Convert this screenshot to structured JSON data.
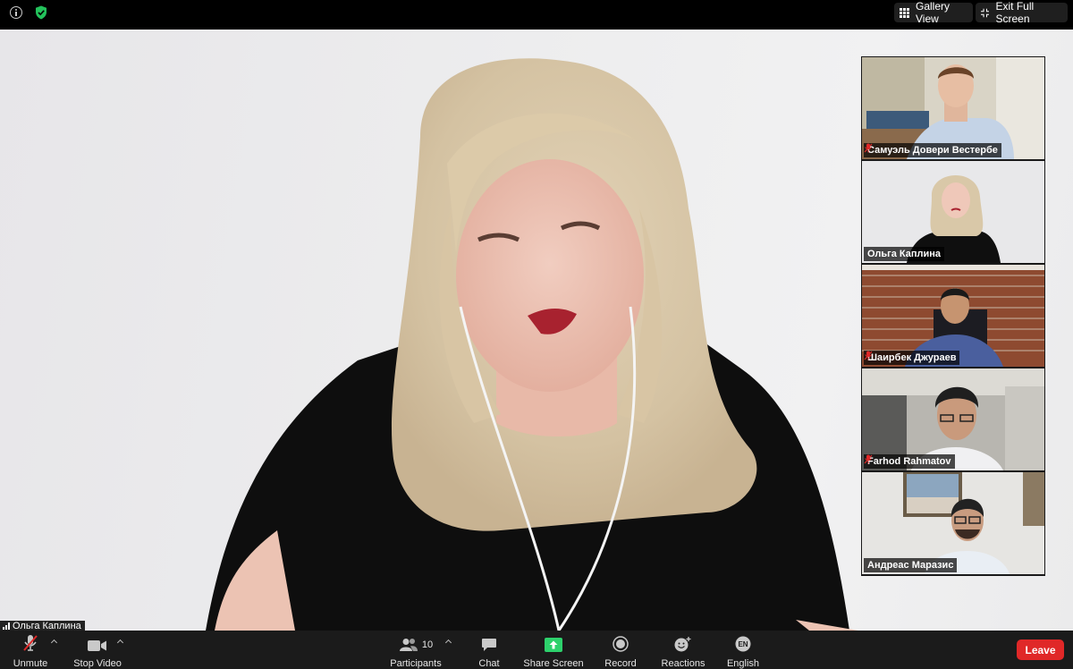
{
  "top_bar": {
    "gallery_view_label": "Gallery View",
    "exit_full_screen_label": "Exit Full Screen"
  },
  "main_video": {
    "speaker_name": "Ольга Каплина"
  },
  "participants_tiles": [
    {
      "name": "Самуэль Довери Вестербе",
      "muted": true,
      "active": false
    },
    {
      "name": "Ольга Каплина",
      "muted": false,
      "active": true
    },
    {
      "name": "Шаирбек Джураев",
      "muted": true,
      "active": false
    },
    {
      "name": "Farhod Rahmatov",
      "muted": true,
      "active": false
    },
    {
      "name": "Андреас Маразис",
      "muted": false,
      "active": false
    }
  ],
  "toolbar": {
    "unmute_label": "Unmute",
    "stop_video_label": "Stop Video",
    "participants_label": "Participants",
    "participants_count": "10",
    "chat_label": "Chat",
    "share_screen_label": "Share Screen",
    "record_label": "Record",
    "reactions_label": "Reactions",
    "language_label": "English",
    "language_badge": "EN",
    "leave_label": "Leave"
  },
  "colors": {
    "share_green": "#2dd16c",
    "leave_red": "#e02828",
    "active_speaker_border": "#c6e04e",
    "muted_red": "#e02828"
  }
}
